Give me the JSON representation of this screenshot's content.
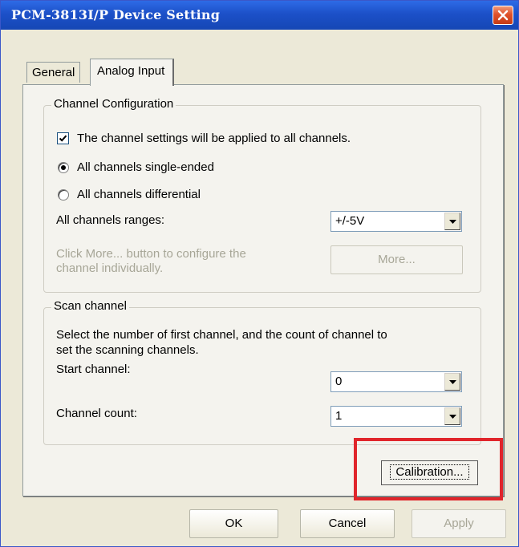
{
  "window": {
    "title": "PCM-3813I/P Device Setting"
  },
  "tabs": [
    {
      "label": "General",
      "active": false
    },
    {
      "label": "Analog Input",
      "active": true
    }
  ],
  "channel_config": {
    "title": "Channel Configuration",
    "apply_all_label": "The channel settings will be applied to all channels.",
    "apply_all_checked": true,
    "radio_single_label": "All channels single-ended",
    "radio_diff_label": "All channels differential",
    "selected_mode": "single-ended",
    "ranges_label": "All channels ranges:",
    "ranges_value": "+/-5V",
    "more_hint_line1": "Click More... button to configure the",
    "more_hint_line2": "channel individually.",
    "more_button": "More..."
  },
  "scan_channel": {
    "title": "Scan channel",
    "description_line1": "Select the number of first channel, and the count of channel to",
    "description_line2": "set the scanning channels.",
    "start_label": "Start channel:",
    "start_value": "0",
    "count_label": "Channel count:",
    "count_value": "1"
  },
  "buttons": {
    "calibration": "Calibration...",
    "ok": "OK",
    "cancel": "Cancel",
    "apply": "Apply"
  },
  "colors": {
    "highlight": "#e0252b",
    "titlebar": "#1c50c8"
  }
}
